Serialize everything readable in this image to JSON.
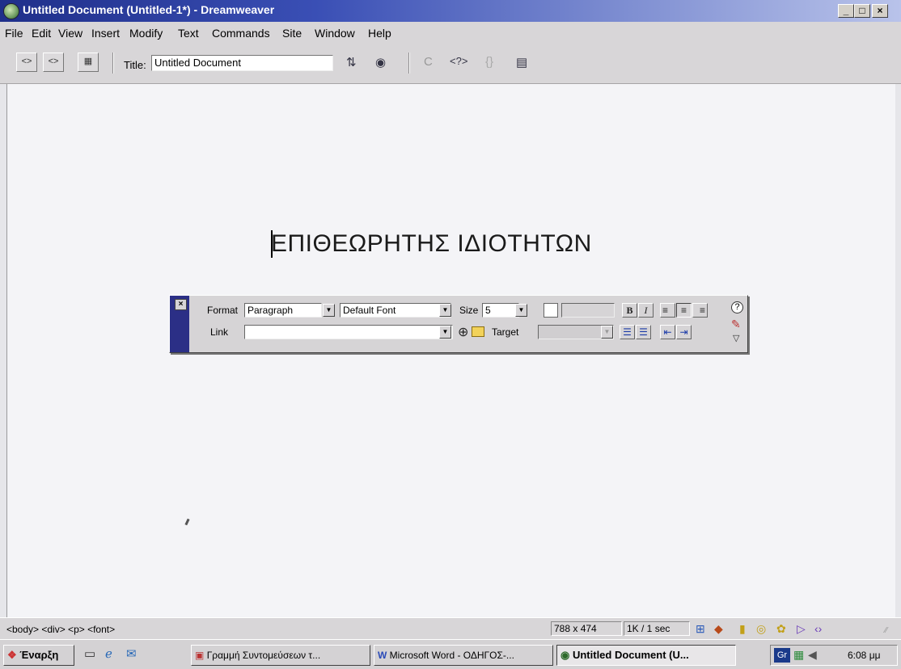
{
  "window": {
    "title": "Untitled Document (Untitled-1*) - Dreamweaver",
    "min_glyph": "_",
    "max_glyph": "□",
    "close_glyph": "×"
  },
  "menu": {
    "items": [
      "File",
      "Edit",
      "View",
      "Insert",
      "Modify",
      "Text",
      "Commands",
      "Site",
      "Window",
      "Help"
    ]
  },
  "toolbar": {
    "code_view_glyph": "<>",
    "split_view_glyph": "<>",
    "design_view_glyph": "▦",
    "title_label": "Title:",
    "title_value": "Untitled Document",
    "file_mgmt_glyph": "⇅",
    "preview_glyph": "◉",
    "refresh_glyph": "C",
    "reference_glyph": "<?>",
    "code_nav_glyph": "{}",
    "view_options_glyph": "▤"
  },
  "document": {
    "heading": "ΕΠΙΘΕΩΡΗΤΗΣ ΙΔΙΟΤΗΤΩΝ"
  },
  "inspector": {
    "close_glyph": "×",
    "format_label": "Format",
    "format_value": "Paragraph",
    "font_value": "Default Font",
    "size_label": "Size",
    "size_value": "5",
    "link_label": "Link",
    "link_value": "",
    "target_label": "Target",
    "target_value": "",
    "bold_glyph": "B",
    "italic_glyph": "I",
    "align_left_glyph": "≡",
    "align_center_glyph": "≡",
    "align_right_glyph": "≡",
    "unordered_list_glyph": "☰",
    "ordered_list_glyph": "☰",
    "outdent_glyph": "⇤",
    "indent_glyph": "⇥",
    "help_glyph": "?",
    "quick_tag_glyph": "✎",
    "expand_glyph": "▽",
    "dropdown_glyph": "▼",
    "point_to_file_glyph": "⊕",
    "browse_folder_glyph": "▭"
  },
  "status": {
    "tag_selector": "<body> <div> <p> <font>",
    "window_size": "788 x 474",
    "download_time": "1K / 1 sec",
    "icons": [
      "site-icon",
      "assets-icon",
      "html-styles-icon",
      "css-styles-icon",
      "behaviors-icon",
      "history-icon",
      "code-inspector-icon"
    ]
  },
  "taskbar": {
    "start_label": "Έναρξη",
    "tasks": [
      {
        "label": "Γραμμή Συντομεύσεων τ..."
      },
      {
        "label": "Microsoft Word - ΟΔΗΓΟΣ-..."
      },
      {
        "label": "Untitled Document (U..."
      }
    ],
    "lang": "Gr",
    "clock": "6:08 μμ"
  }
}
